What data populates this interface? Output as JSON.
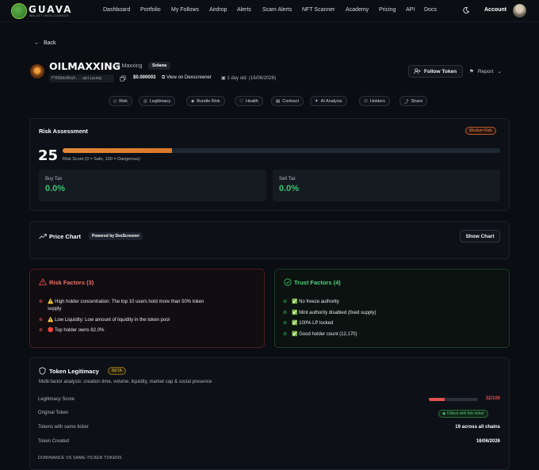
{
  "nav": {
    "logo_word": "GUAVA",
    "logo_sub": "WALLET INTELLIGENCE",
    "links": [
      "Dashboard",
      "Portfolio",
      "My Follows",
      "Airdrop",
      "Alerts",
      "Scam Alerts",
      "NFT Scanner",
      "Academy",
      "Pricing",
      "API",
      "Docs"
    ],
    "account": "Account"
  },
  "back": "Back",
  "token": {
    "symbol": "OILMAXXING",
    "name": "Oil Maxxing",
    "chain": "Solana",
    "address": "FfRQbb9KaX...qmiipump",
    "price": "$0.000003",
    "dex_link": "View on Dexscreener",
    "age": "1 day old",
    "created": "(16/06/2026)"
  },
  "actions": {
    "follow": "Follow Token",
    "report": "Report"
  },
  "tabs": [
    "Risk",
    "Legitimacy",
    "Bundle Risk",
    "Health",
    "Contract",
    "AI Analysis",
    "Holders",
    "Share"
  ],
  "risk_assessment": {
    "title": "Risk Assessment",
    "badge": "Medium Risk",
    "score": "25",
    "score_fraction": 0.25,
    "caption": "Risk Score (0 = Safe, 100 = Dangerous)",
    "buy_tax_label": "Buy Tax",
    "buy_tax": "0.0%",
    "sell_tax_label": "Sell Tax",
    "sell_tax": "0.0%"
  },
  "price_chart": {
    "title": "Price Chart",
    "powered": "Powered by DexScreener",
    "button": "Show Chart"
  },
  "risk_factors": {
    "title": "Risk Factors (3)",
    "items": [
      "⚠️ High holder concentration: The top 10 users hold more than 50% token",
      "supply",
      "⚠️ Low Liquidity: Low amount of liquidity in the token pool",
      "🔴 Top holder owns 82.0%"
    ]
  },
  "trust_factors": {
    "title": "Trust Factors (4)",
    "items": [
      "✅ No freeze authority",
      "✅ Mint authority disabled (fixed supply)",
      "✅ 100% LP locked",
      "✅ Good holder count (12,170)"
    ]
  },
  "legitimacy": {
    "title": "Token Legitimacy",
    "badge": "BETA",
    "subtitle": "Multi-factor analysis: creation time, volume, liquidity, market cap & social presence",
    "score_label": "Legitimacy Score",
    "score": "32/100",
    "score_fraction": 0.32,
    "original_label": "Original Token",
    "original_badge": "Oldest with this ticker",
    "same_ticker_label": "Tokens with same ticker",
    "same_ticker_value": "19 across all chains",
    "created_label": "Token Created",
    "created_value": "16/06/2026",
    "dominance_label": "DOMINANCE VS SAME-TICKER TOKENS"
  },
  "colors": {
    "accent_orange": "#e3873a",
    "green": "#38c46e",
    "red": "#e0514f"
  }
}
